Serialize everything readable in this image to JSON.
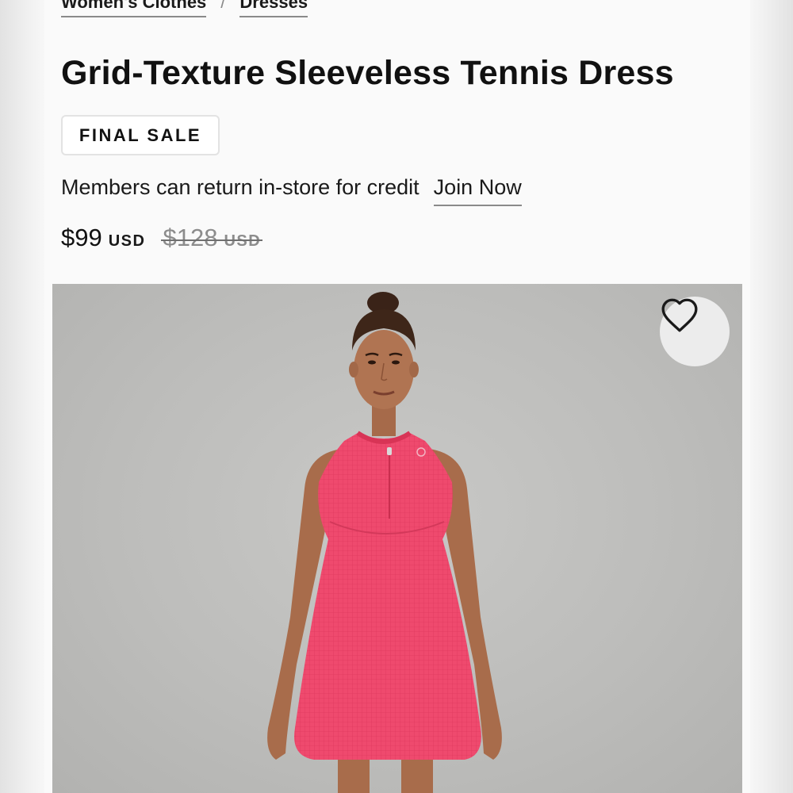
{
  "breadcrumb": {
    "items": [
      "Women's Clothes",
      "Dresses"
    ],
    "separator": "/"
  },
  "product": {
    "title": "Grid-Texture Sleeveless Tennis Dress",
    "badge": "FINAL SALE",
    "membership_note": "Members can return in-store for credit",
    "join_label": "Join Now",
    "price": {
      "current": "$99",
      "current_currency": "USD",
      "original": "$128",
      "original_currency": "USD"
    },
    "image": {
      "dress_color": "#ef4a6e",
      "background_color": "#c3c3c1"
    },
    "wishlist_icon": "heart-icon"
  }
}
